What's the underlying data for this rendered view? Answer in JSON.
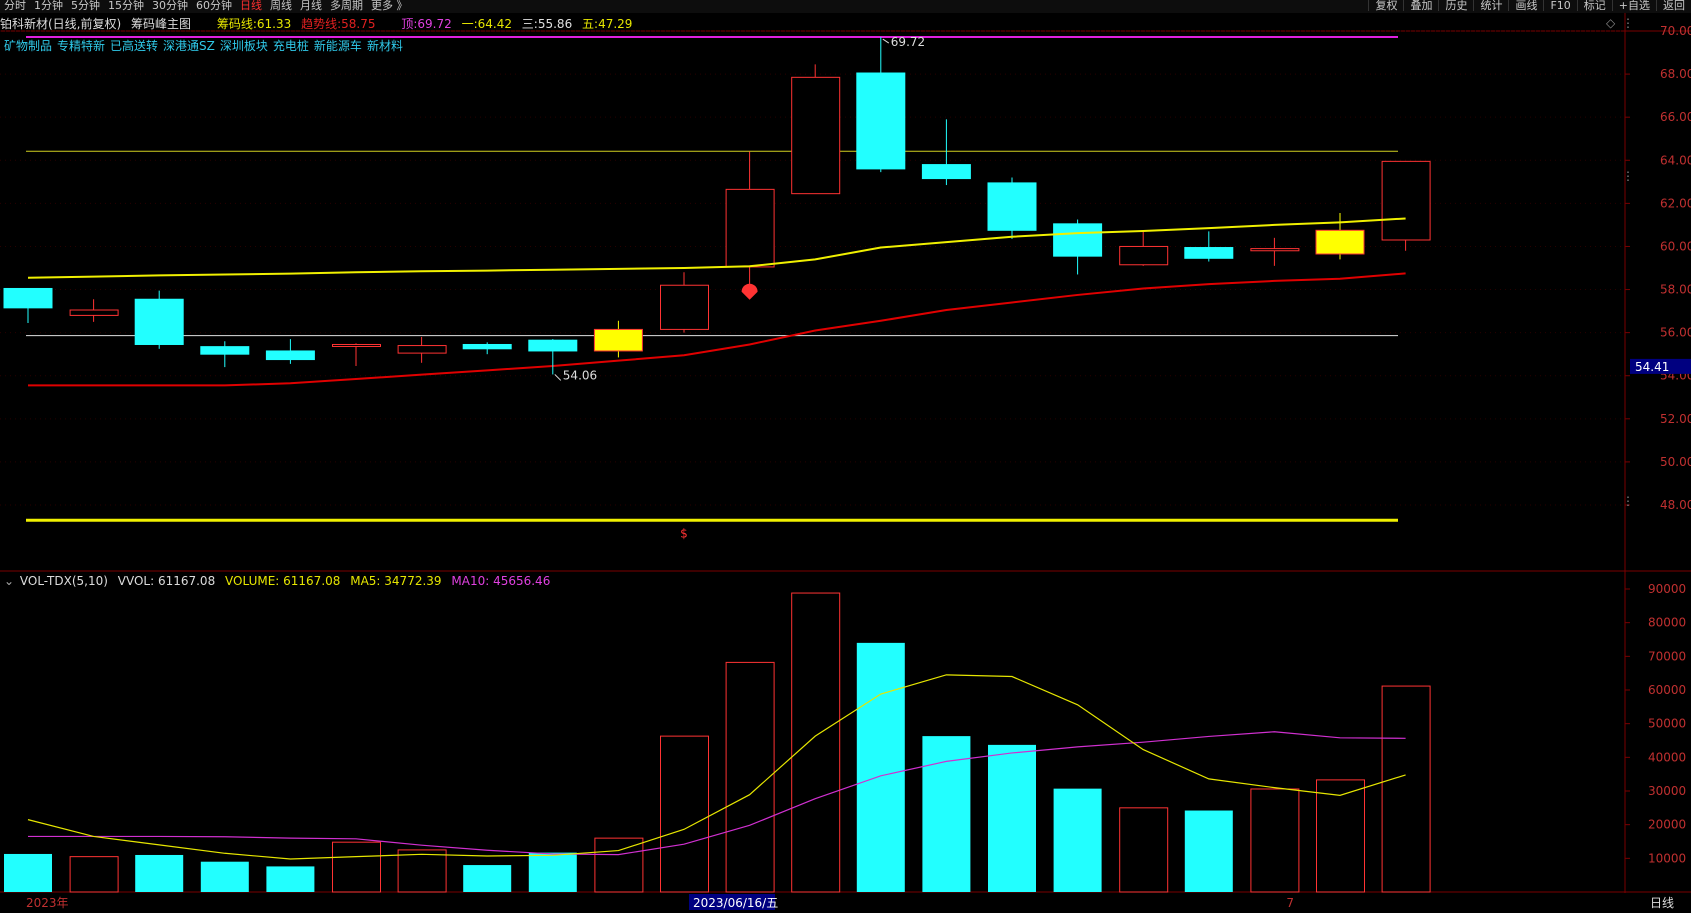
{
  "toolbar": {
    "timeframes": [
      "分时",
      "1分钟",
      "5分钟",
      "15分钟",
      "30分钟",
      "60分钟",
      "日线",
      "周线",
      "月线",
      "多周期",
      "更多 》"
    ],
    "active": "日线",
    "right_buttons": [
      "复权",
      "叠加",
      "历史",
      "统计",
      "画线",
      "F10",
      "标记",
      "+自选",
      "返回"
    ]
  },
  "header": {
    "stock": "铂科新材(日线,前复权)",
    "indicator": "筹码峰主图",
    "chip_label": "筹码线:",
    "chip_value": "61.33",
    "trend_label": "趋势线:",
    "trend_value": "58.75",
    "top_label": "顶:",
    "top_value": "69.72",
    "l1_label": "一:",
    "l1_value": "64.42",
    "l3_label": "三:",
    "l3_value": "55.86",
    "l5_label": "五:",
    "l5_value": "47.29"
  },
  "tags": [
    "矿物制品",
    "专精特新",
    "已高送转",
    "深港通SZ",
    "深圳板块",
    "充电桩",
    "新能源车",
    "新材料"
  ],
  "volume_header": {
    "name": "VOL-TDX(5,10)",
    "vvol": "VVOL: 61167.08",
    "volume": "VOLUME: 61167.08",
    "ma5": "MA5: 34772.39",
    "ma10": "MA10: 45656.46"
  },
  "footer": {
    "year_label": "2023年",
    "date_label": "2023/06/16/五",
    "month_label": "7",
    "period_label": "日线"
  },
  "colors": {
    "up": "#ff3333",
    "down": "#22ffff",
    "highlight": "#ffff00",
    "ma_yellow": "#f0f000",
    "ma_red": "#e00000",
    "ma5": "#e6e600",
    "ma10": "#d030d0",
    "grid": "#7a0000",
    "axis_text": "#c03030"
  },
  "chart_data": [
    {
      "type": "candlestick",
      "price_axis": {
        "ticks": [
          "70.00",
          "68.00",
          "66.00",
          "64.00",
          "62.00",
          "60.00",
          "58.00",
          "56.00",
          "54.00",
          "52.00",
          "50.00",
          "48.00"
        ],
        "current_price_label": "54.41"
      },
      "ylim": [
        47,
        71
      ],
      "candles": [
        {
          "open": 57.15,
          "close": 58.05,
          "high": 58.0,
          "low": 56.45,
          "dir": "down"
        },
        {
          "open": 56.8,
          "close": 57.05,
          "high": 57.55,
          "low": 56.5,
          "dir": "up"
        },
        {
          "open": 57.55,
          "close": 55.45,
          "high": 57.95,
          "low": 55.25,
          "dir": "down"
        },
        {
          "open": 55.35,
          "close": 55.0,
          "high": 55.6,
          "low": 54.4,
          "dir": "down"
        },
        {
          "open": 55.15,
          "close": 54.75,
          "high": 55.7,
          "low": 54.55,
          "dir": "down"
        },
        {
          "open": 55.4,
          "close": 55.45,
          "high": 55.5,
          "low": 54.45,
          "dir": "up"
        },
        {
          "open": 55.05,
          "close": 55.4,
          "high": 55.8,
          "low": 54.6,
          "dir": "up"
        },
        {
          "open": 55.45,
          "close": 55.25,
          "high": 55.55,
          "low": 55.0,
          "dir": "down"
        },
        {
          "open": 55.65,
          "close": 55.15,
          "high": 55.7,
          "low": 54.06,
          "dir": "down"
        },
        {
          "open": 55.15,
          "close": 56.15,
          "high": 56.55,
          "low": 54.85,
          "dir": "up",
          "flag": true
        },
        {
          "open": 56.15,
          "close": 58.2,
          "high": 58.8,
          "low": 56.0,
          "dir": "up"
        },
        {
          "open": 59.05,
          "close": 62.65,
          "high": 64.4,
          "low": 58.05,
          "dir": "up"
        },
        {
          "open": 62.45,
          "close": 67.85,
          "high": 68.45,
          "low": 62.45,
          "dir": "up"
        },
        {
          "open": 68.05,
          "close": 63.6,
          "high": 69.72,
          "low": 63.45,
          "dir": "down"
        },
        {
          "open": 63.8,
          "close": 63.15,
          "high": 65.9,
          "low": 62.85,
          "dir": "down"
        },
        {
          "open": 62.95,
          "close": 60.75,
          "high": 63.2,
          "low": 60.35,
          "dir": "down"
        },
        {
          "open": 61.05,
          "close": 59.55,
          "high": 61.25,
          "low": 58.7,
          "dir": "down"
        },
        {
          "open": 59.15,
          "close": 60.0,
          "high": 60.7,
          "low": 59.1,
          "dir": "up"
        },
        {
          "open": 59.95,
          "close": 59.45,
          "high": 60.7,
          "low": 59.3,
          "dir": "down"
        },
        {
          "open": 59.8,
          "close": 59.9,
          "high": 60.4,
          "low": 59.1,
          "dir": "up"
        },
        {
          "open": 59.65,
          "close": 60.75,
          "high": 61.55,
          "low": 59.4,
          "dir": "up",
          "flag": true
        },
        {
          "open": 60.3,
          "close": 63.95,
          "high": 63.95,
          "low": 59.8,
          "dir": "up"
        }
      ],
      "ma_yellow": [
        58.55,
        58.6,
        58.66,
        58.7,
        58.74,
        58.8,
        58.85,
        58.88,
        58.92,
        58.96,
        59.0,
        59.08,
        59.4,
        59.95,
        60.2,
        60.45,
        60.62,
        60.72,
        60.85,
        61.0,
        61.12,
        61.3
      ],
      "ma_red": [
        53.55,
        53.55,
        53.55,
        53.55,
        53.65,
        53.85,
        54.05,
        54.25,
        54.45,
        54.7,
        54.95,
        55.45,
        56.1,
        56.55,
        57.05,
        57.4,
        57.75,
        58.05,
        58.25,
        58.4,
        58.5,
        58.75
      ],
      "hlines": {
        "top": 69.72,
        "line1": 64.42,
        "line3": 55.86,
        "line5": 47.29
      },
      "annotations": {
        "high_label": "69.72",
        "low_label": "54.06",
        "marker": "$"
      }
    },
    {
      "type": "bar",
      "volume_axis": {
        "ticks": [
          "90000",
          "80000",
          "70000",
          "60000",
          "50000",
          "40000",
          "30000",
          "20000",
          "10000"
        ]
      },
      "ylim": [
        0,
        92000
      ],
      "volumes": [
        11300,
        10500,
        11000,
        9000,
        7600,
        14800,
        12500,
        8000,
        11700,
        16000,
        46300,
        68200,
        88800,
        74000,
        46300,
        43700,
        30700,
        25000,
        24200,
        30600,
        33300,
        61167.08
      ],
      "ma5": [
        21500,
        16500,
        14000,
        11500,
        9800,
        10500,
        11200,
        10700,
        10900,
        12300,
        18600,
        28900,
        46300,
        58800,
        64500,
        64000,
        55600,
        42300,
        33600,
        31000,
        28700,
        34772.39
      ],
      "ma10": [
        16500,
        16500,
        16500,
        16400,
        16000,
        15800,
        13900,
        12400,
        11300,
        11100,
        14200,
        19800,
        27700,
        34500,
        38800,
        41300,
        43100,
        44500,
        46200,
        47600,
        45800,
        45656.46
      ]
    }
  ]
}
